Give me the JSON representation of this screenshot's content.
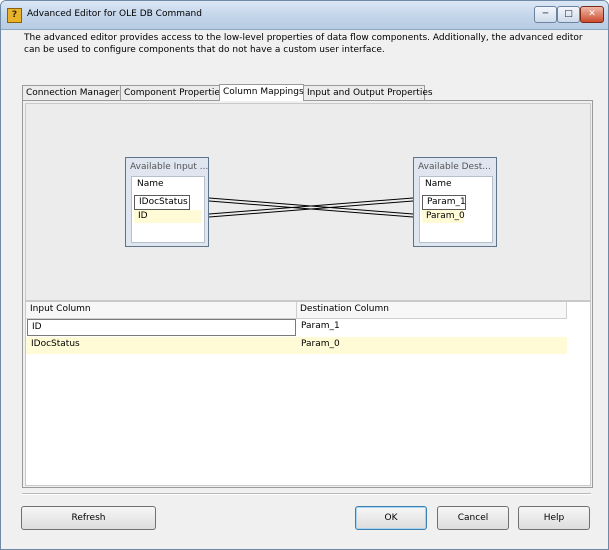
{
  "window": {
    "title": "Advanced Editor for OLE DB Command",
    "app_icon": "?",
    "controls": {
      "minimize": "─",
      "maximize": "□",
      "close": "✕"
    }
  },
  "description": "The advanced editor provides access to the low-level properties of data flow components. Additionally, the advanced editor can be used to configure components that do not have a custom user interface.",
  "tabs": [
    {
      "label": "Connection Managers",
      "active": false
    },
    {
      "label": "Component Properties",
      "active": false
    },
    {
      "label": "Column Mappings",
      "active": true
    },
    {
      "label": "Input and Output Properties",
      "active": false
    }
  ],
  "mapping": {
    "input_box": {
      "title": "Available Input ...",
      "header": "Name",
      "items": [
        "IDocStatus",
        "ID"
      ]
    },
    "destination_box": {
      "title": "Available Dest...",
      "header": "Name",
      "items": [
        "Param_1",
        "Param_0"
      ]
    }
  },
  "grid": {
    "columns": [
      "Input Column",
      "Destination Column"
    ],
    "rows": [
      {
        "input": "ID",
        "destination": "Param_1"
      },
      {
        "input": "IDocStatus",
        "destination": "Param_0"
      }
    ]
  },
  "buttons": {
    "refresh": "Refresh",
    "ok": "OK",
    "cancel": "Cancel",
    "help": "Help"
  },
  "colors": {
    "mapped_row": "#fffbd6",
    "titlebar": "#c3d5ea"
  }
}
